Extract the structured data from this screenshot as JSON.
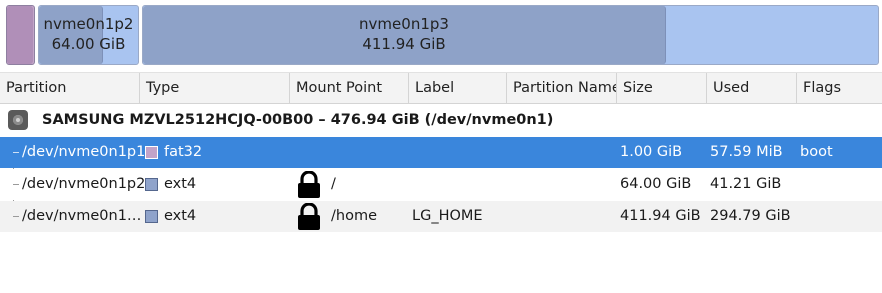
{
  "disk_map": {
    "segments": [
      {
        "name": "",
        "size": "",
        "fs_color": "#c2a3c9"
      },
      {
        "name": "nvme0n1p2",
        "size": "64.00 GiB",
        "fs_color": "#8fa3cb"
      },
      {
        "name": "nvme0n1p3",
        "size": "411.94 GiB",
        "fs_color": "#8fa3cb"
      }
    ]
  },
  "table": {
    "headers": [
      "Partition",
      "Type",
      "Mount Point",
      "Label",
      "Partition Name",
      "Size",
      "Used",
      "Flags"
    ],
    "disk": {
      "title": "SAMSUNG MZVL2512HCJQ-00B00 – 476.94 GiB (/dev/nvme0n1)",
      "icon": "disk-icon"
    },
    "rows": [
      {
        "partition": "/dev/nvme0n1p1",
        "type": "fat32",
        "mount": "",
        "locked": false,
        "label": "",
        "partition_name": "",
        "size": "1.00 GiB",
        "used": "57.59 MiB",
        "flags": "boot",
        "selected": true
      },
      {
        "partition": "/dev/nvme0n1p2",
        "type": "ext4",
        "mount": "/",
        "locked": true,
        "label": "",
        "partition_name": "",
        "size": "64.00 GiB",
        "used": "41.21 GiB",
        "flags": "",
        "selected": false
      },
      {
        "partition": "/dev/nvme0n1…",
        "type": "ext4",
        "mount": "/home",
        "locked": true,
        "label": "LG_HOME",
        "partition_name": "",
        "size": "411.94 GiB",
        "used": "294.79 GiB",
        "flags": "",
        "selected": false
      }
    ]
  },
  "colors": {
    "selection": "#3a86dc",
    "fat32": "#c2a3c9",
    "ext4": "#8fa3cb",
    "unused_space": "#a9c4f0"
  }
}
